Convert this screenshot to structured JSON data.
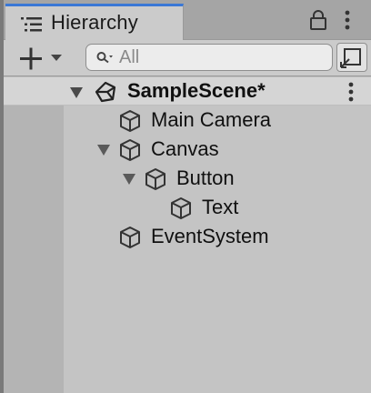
{
  "window": {
    "tab_title": "Hierarchy",
    "tab_icon": "hierarchy-list-icon"
  },
  "toolbar": {
    "add_icon": "plus-icon",
    "dropdown_icon": "triangle-down-icon",
    "search_placeholder": "All",
    "search_value": "",
    "search_icon": "search-icon",
    "scene_search_icon": "scene-search-icon"
  },
  "hierarchy": {
    "scene": {
      "name": "SampleScene*",
      "icon": "unity-logo-icon",
      "expanded": true
    },
    "items": [
      {
        "label": "Main Camera",
        "depth": 1,
        "expandable": false,
        "icon": "gameobject-cube-icon"
      },
      {
        "label": "Canvas",
        "depth": 1,
        "expandable": true,
        "expanded": true,
        "icon": "gameobject-cube-icon"
      },
      {
        "label": "Button",
        "depth": 2,
        "expandable": true,
        "expanded": true,
        "icon": "gameobject-cube-icon"
      },
      {
        "label": "Text",
        "depth": 3,
        "expandable": false,
        "icon": "gameobject-cube-icon"
      },
      {
        "label": "EventSystem",
        "depth": 1,
        "expandable": false,
        "icon": "gameobject-cube-icon"
      }
    ]
  },
  "colors": {
    "tab_accent": "#3a78d6",
    "panel_bg": "#c4c4c4",
    "scene_row_bg": "#d5d5d5"
  }
}
